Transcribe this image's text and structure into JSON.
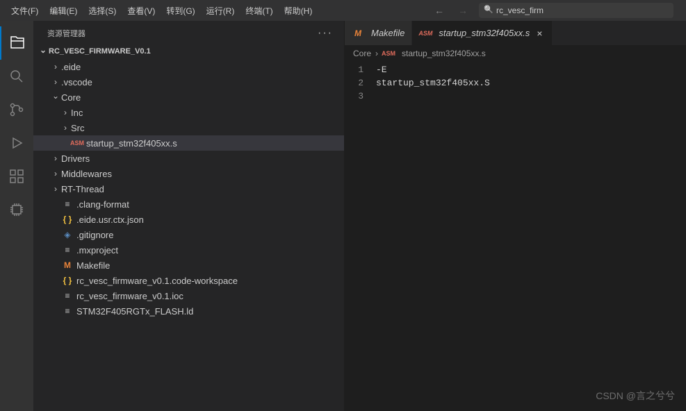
{
  "menubar": {
    "items": [
      "文件(F)",
      "编辑(E)",
      "选择(S)",
      "查看(V)",
      "转到(G)",
      "运行(R)",
      "终端(T)",
      "帮助(H)"
    ],
    "search_text": "rc_vesc_firm"
  },
  "sidebar": {
    "title": "资源管理器",
    "project_name": "RC_VESC_FIRMWARE_V0.1",
    "tree": [
      {
        "name": ".eide",
        "type": "folder",
        "expanded": false,
        "indent": 1
      },
      {
        "name": ".vscode",
        "type": "folder",
        "expanded": false,
        "indent": 1
      },
      {
        "name": "Core",
        "type": "folder",
        "expanded": true,
        "indent": 1
      },
      {
        "name": "Inc",
        "type": "folder",
        "expanded": false,
        "indent": 2
      },
      {
        "name": "Src",
        "type": "folder",
        "expanded": false,
        "indent": 2
      },
      {
        "name": "startup_stm32f405xx.s",
        "type": "asm",
        "indent": 2,
        "selected": true
      },
      {
        "name": "Drivers",
        "type": "folder",
        "expanded": false,
        "indent": 1
      },
      {
        "name": "Middlewares",
        "type": "folder",
        "expanded": false,
        "indent": 1
      },
      {
        "name": "RT-Thread",
        "type": "folder",
        "expanded": false,
        "indent": 1
      },
      {
        "name": ".clang-format",
        "type": "file",
        "indent": 1
      },
      {
        "name": ".eide.usr.ctx.json",
        "type": "json",
        "indent": 1
      },
      {
        "name": ".gitignore",
        "type": "git",
        "indent": 1
      },
      {
        "name": ".mxproject",
        "type": "file",
        "indent": 1
      },
      {
        "name": "Makefile",
        "type": "make",
        "indent": 1
      },
      {
        "name": "rc_vesc_firmware_v0.1.code-workspace",
        "type": "json",
        "indent": 1
      },
      {
        "name": "rc_vesc_firmware_v0.1.ioc",
        "type": "file",
        "indent": 1
      },
      {
        "name": "STM32F405RGTx_FLASH.ld",
        "type": "file",
        "indent": 1
      }
    ]
  },
  "editor": {
    "tabs": [
      {
        "label": "Makefile",
        "icon": "make",
        "active": false
      },
      {
        "label": "startup_stm32f405xx.s",
        "icon": "asm",
        "active": true
      }
    ],
    "breadcrumb": {
      "parent": "Core",
      "file": "startup_stm32f405xx.s"
    },
    "lines": [
      {
        "num": "1",
        "content": "-E"
      },
      {
        "num": "2",
        "content": "startup_stm32f405xx.S"
      },
      {
        "num": "3",
        "content": ""
      }
    ]
  },
  "icons": {
    "asm_text": "ASM",
    "make_text": "M",
    "lines_text": "≡",
    "json_text": "{ }",
    "git_text": "◈"
  },
  "watermark": "CSDN @言之兮兮"
}
